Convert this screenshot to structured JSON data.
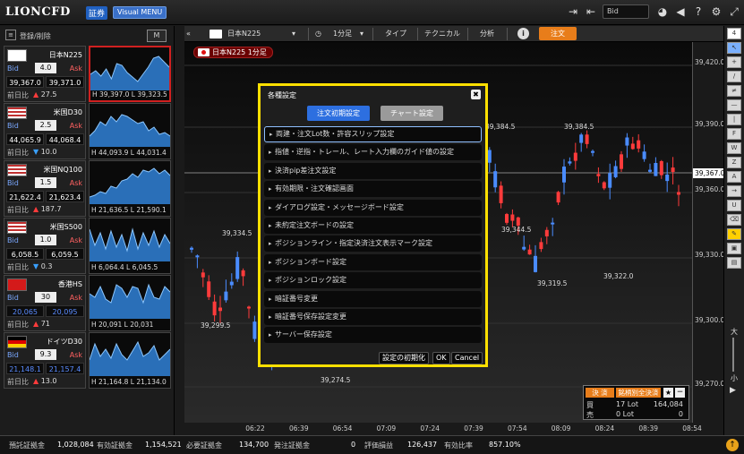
{
  "app": {
    "logo": "LIONCFD",
    "logo_badge": "証券",
    "visual_menu": "Visual MENU",
    "bid_select": "Bid",
    "top_icons": [
      "logout-icon",
      "login-icon",
      "dropdown-caret-icon",
      "pie-chart-icon",
      "megaphone-icon",
      "question-icon",
      "gear-icon",
      "fullscreen-icon"
    ]
  },
  "watchlist": {
    "register_label": "登録/削除",
    "m_button": "M",
    "bid_label": "Bid",
    "ask_label": "Ask",
    "prev_label": "前日比",
    "items": [
      {
        "name": "日本N225",
        "flag": "JP",
        "spread": "4.0",
        "bid": "39,367.0",
        "ask": "39,371.0",
        "direction": "up",
        "change": "27.5",
        "hl": "H 39,397.0  L 39,323.5",
        "bid_color": "white",
        "selected": true
      },
      {
        "name": "米国D30",
        "flag": "US",
        "spread": "2.5",
        "bid": "44,065.9",
        "ask": "44,068.4",
        "direction": "down",
        "change": "10.0",
        "hl": "H 44,093.9  L 44,031.4",
        "bid_color": "white",
        "selected": false
      },
      {
        "name": "米国NQ100",
        "flag": "US",
        "spread": "1.5",
        "bid": "21,622.4",
        "ask": "21,623.4",
        "direction": "up",
        "change": "187.7",
        "hl": "H 21,636.5  L 21,590.1",
        "bid_color": "white",
        "selected": false
      },
      {
        "name": "米国S500",
        "flag": "US",
        "spread": "1.0",
        "bid": "6,058.5",
        "ask": "6,059.5",
        "direction": "down",
        "change": "0.3",
        "hl": "H 6,064.4  L 6,045.5",
        "bid_color": "white",
        "selected": false
      },
      {
        "name": "香港HS",
        "flag": "HK",
        "spread": "30",
        "bid": "20,065",
        "ask": "20,095",
        "direction": "up",
        "change": "71",
        "hl": "H 20,091  L 20,031",
        "bid_color": "blue",
        "selected": false
      },
      {
        "name": "ドイツD30",
        "flag": "DE",
        "spread": "9.3",
        "bid": "21,148.1",
        "ask": "21,157.4",
        "direction": "up",
        "change": "13.0",
        "hl": "H 21,164.8  L 21,134.0",
        "bid_color": "blue",
        "selected": false
      }
    ]
  },
  "chart_toolbar": {
    "symbol": "日本N225",
    "timeframe": "1分足",
    "type": "タイプ",
    "technical": "テクニカル",
    "analysis": "分析",
    "info": "i",
    "order": "注文"
  },
  "chart": {
    "tag": "日本N225 1分足",
    "current_price": "39,367.0",
    "y_labels": [
      "39,420.0",
      "39,390.0",
      "39,360.0",
      "39,330.0",
      "39,300.0",
      "39,270.0"
    ],
    "x_labels": [
      "06:22",
      "06:39",
      "06:54",
      "07:09",
      "07:24",
      "07:39",
      "07:54",
      "08:09",
      "08:24",
      "08:39",
      "08:54"
    ],
    "annotations": [
      "39,384.5",
      "39,384.5",
      "39,334.5",
      "39,344.5",
      "39,299.5",
      "39,319.5",
      "39,322.0",
      "39,274.5"
    ]
  },
  "position_box": {
    "settle": "決 済",
    "settle_all": "銘柄別全決済",
    "buy_label": "買",
    "buy_lot": "17 Lot",
    "buy_value": "164,084",
    "sell_label": "売",
    "sell_lot": "0 Lot",
    "sell_value": "0"
  },
  "statusbar": {
    "items": [
      {
        "label": "預託証拠金",
        "value": "1,028,084"
      },
      {
        "label": "有効証拠金",
        "value": "1,154,521"
      },
      {
        "label": "必要証拠金",
        "value": "134,700"
      },
      {
        "label": "発注証拠金",
        "value": "0"
      },
      {
        "label": "評価損益",
        "value": "126,437"
      },
      {
        "label": "有効比率",
        "value": "857.10%"
      }
    ]
  },
  "dialog": {
    "title": "各種設定",
    "tab_order": "注文初期設定",
    "tab_chart": "チャート設定",
    "items": [
      "両建・注文Lot数・許容スリップ設定",
      "指値・逆指・トレール、レート入力欄のガイド値の設定",
      "決済pip差注文設定",
      "有効期限・注文確認画面",
      "ダイアログ設定・メッセージボード設定",
      "未約定注文ボードの設定",
      "ポジションライン・指定決済注文表示マーク設定",
      "ポジションボード設定",
      "ポジションロック設定",
      "暗証番号変更",
      "暗証番号保存設定変更",
      "サーバー保存設定"
    ],
    "reset_button": "設定の初期化",
    "ok_button": "OK",
    "cancel_button": "Cancel"
  },
  "colors": {
    "up": "#ff3b3b",
    "down": "#3aa0ff",
    "accent_orange": "#e87d1a",
    "dialog_border": "#ffe000",
    "tab_blue": "#2d6fe0"
  }
}
